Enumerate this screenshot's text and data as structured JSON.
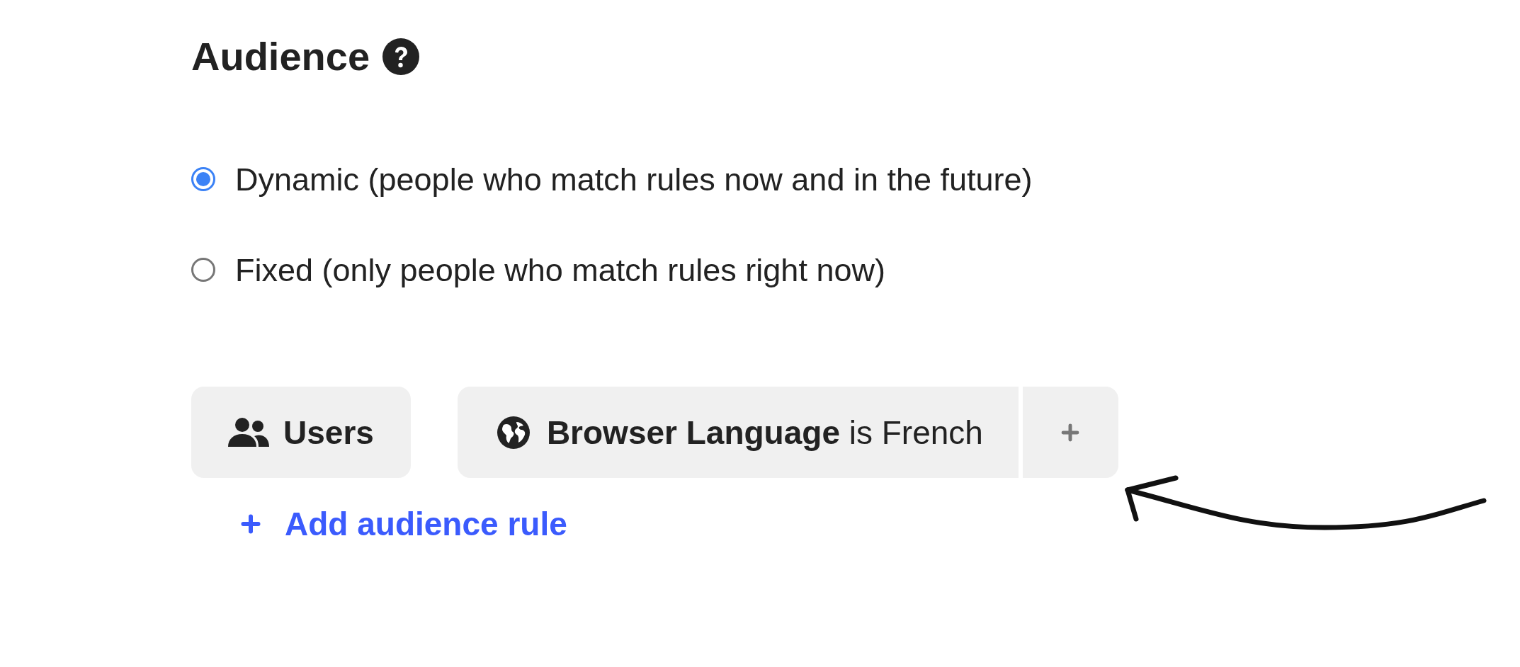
{
  "heading": {
    "title": "Audience"
  },
  "audience_type": [
    {
      "label": "Dynamic (people who match rules now and in the future)",
      "selected": true
    },
    {
      "label": "Fixed (only people who match rules right now)",
      "selected": false
    }
  ],
  "rule": {
    "subject": "Users",
    "conditions": [
      {
        "text": "**Browser Language** is French"
      }
    ]
  },
  "add_rule": {
    "label": "Add audience rule"
  }
}
